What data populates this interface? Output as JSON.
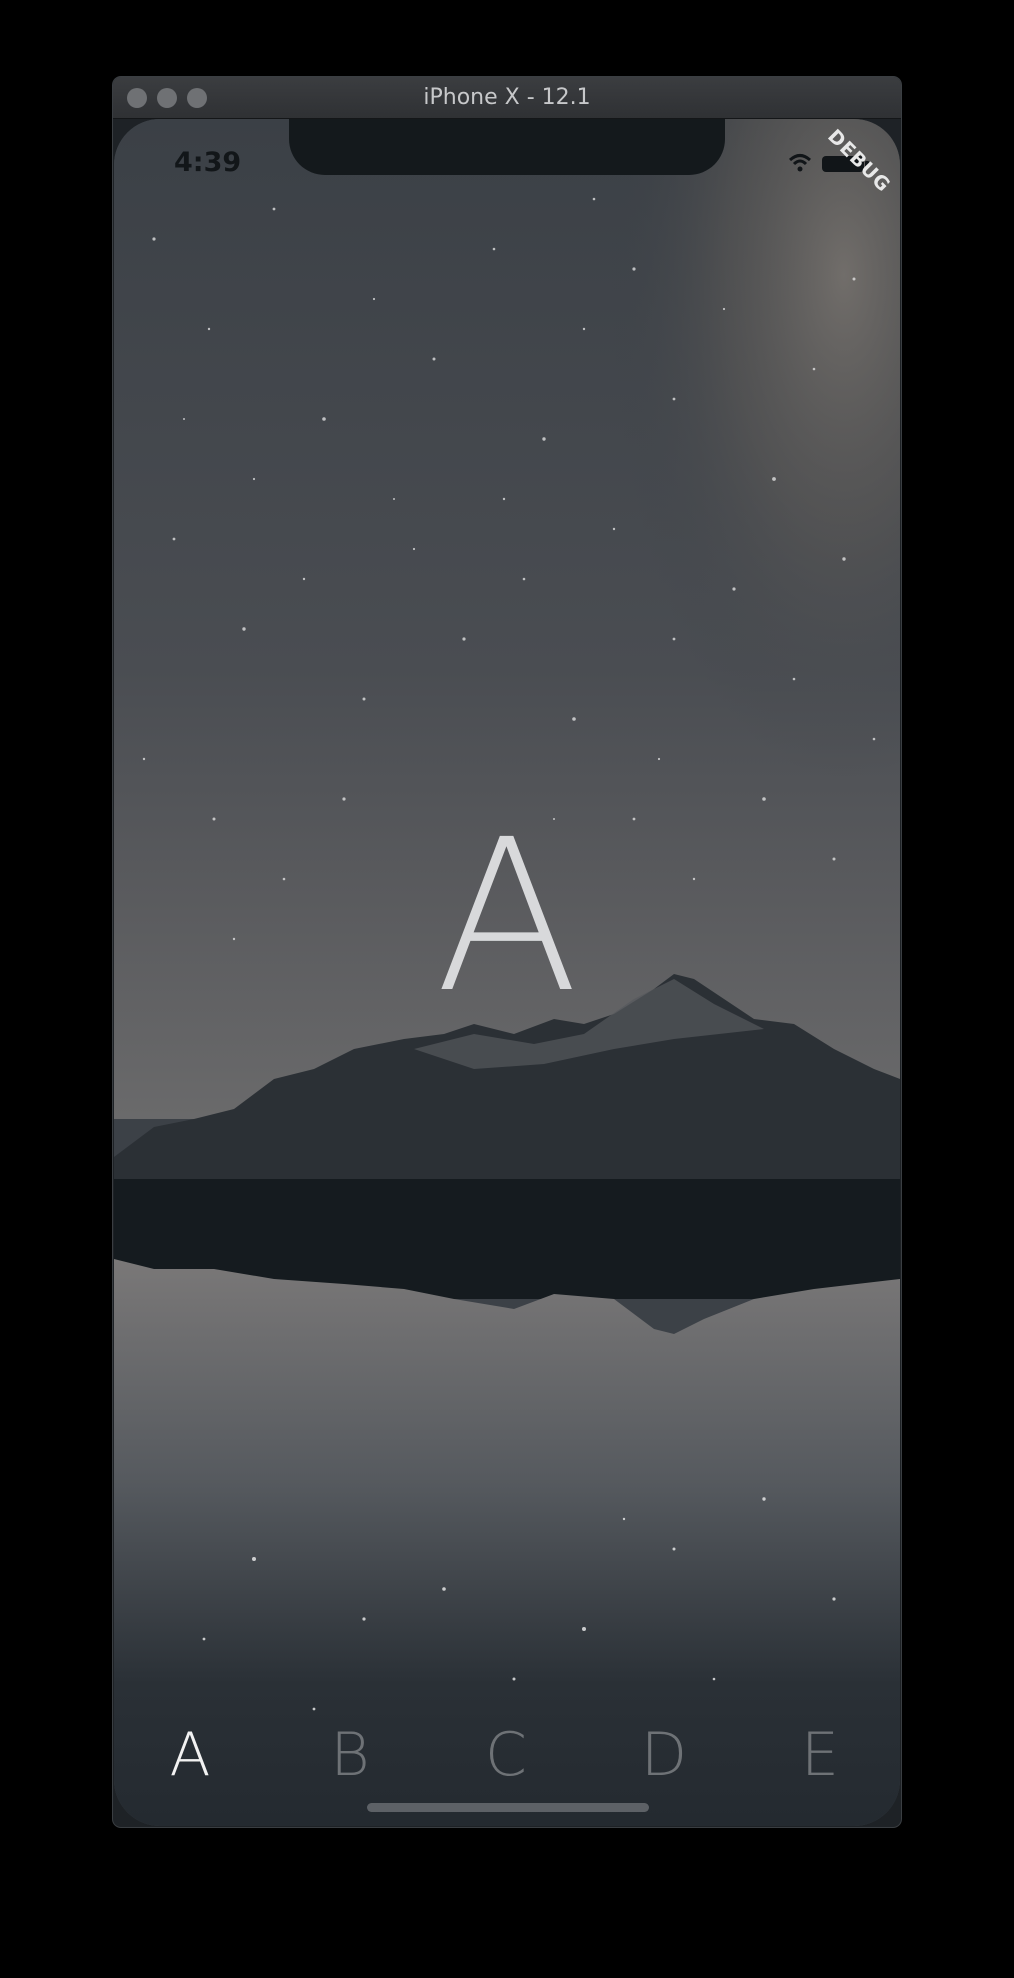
{
  "window": {
    "title": "iPhone X - 12.1"
  },
  "status_bar": {
    "time": "4:39",
    "debug_label": "DEBUG"
  },
  "page": {
    "selected_letter": "A"
  },
  "tabs": [
    {
      "label": "A",
      "active": true
    },
    {
      "label": "B",
      "active": false
    },
    {
      "label": "C",
      "active": false
    },
    {
      "label": "D",
      "active": false
    },
    {
      "label": "E",
      "active": false
    }
  ],
  "colors": {
    "sky": "#3c4147",
    "mountain": "#2a2f33",
    "lake": "#14191c",
    "active_tab": "#f2f2f2",
    "inactive_tab": "#6e7276"
  },
  "icons": [
    "wifi-icon",
    "battery-icon"
  ]
}
